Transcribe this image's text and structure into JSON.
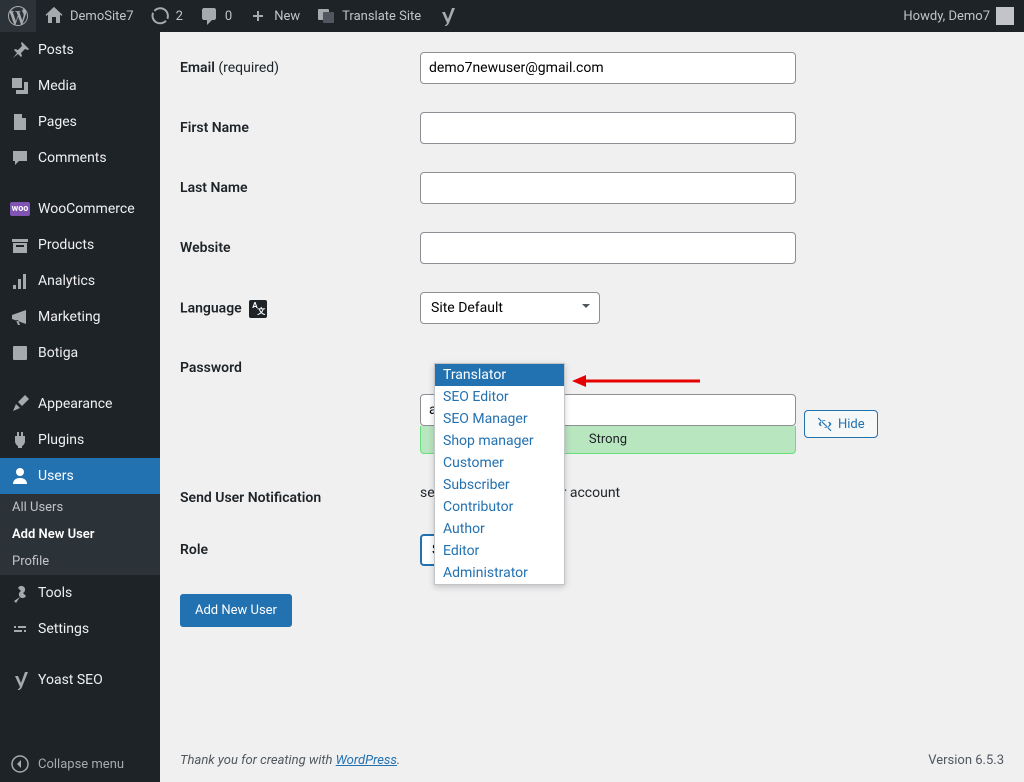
{
  "adminbar": {
    "site_name": "DemoSite7",
    "updates_count": "2",
    "comments_count": "0",
    "new_label": "New",
    "translate_label": "Translate Site",
    "howdy": "Howdy, Demo7"
  },
  "sidebar": {
    "posts": "Posts",
    "media": "Media",
    "pages": "Pages",
    "comments": "Comments",
    "woocommerce": "WooCommerce",
    "products": "Products",
    "analytics": "Analytics",
    "marketing": "Marketing",
    "botiga": "Botiga",
    "appearance": "Appearance",
    "plugins": "Plugins",
    "users": "Users",
    "users_sub": {
      "all": "All Users",
      "add": "Add New User",
      "profile": "Profile"
    },
    "tools": "Tools",
    "settings": "Settings",
    "yoast": "Yoast SEO",
    "collapse": "Collapse menu"
  },
  "form": {
    "email_label": "Email",
    "email_required": "(required)",
    "email_value": "demo7newuser@gmail.com",
    "firstname_label": "First Name",
    "lastname_label": "Last Name",
    "website_label": "Website",
    "language_label": "Language",
    "language_value": "Site Default",
    "password_label": "Password",
    "password_value": "amb9(rluK",
    "hide_label": "Hide",
    "strength": "Strong",
    "notification_label": "Send User Notification",
    "notification_desc": "ser an email about their account",
    "role_label": "Role",
    "role_value": "Subscriber",
    "submit": "Add New User"
  },
  "role_options": {
    "o0": "Translator",
    "o1": "SEO Editor",
    "o2": "SEO Manager",
    "o3": "Shop manager",
    "o4": "Customer",
    "o5": "Subscriber",
    "o6": "Contributor",
    "o7": "Author",
    "o8": "Editor",
    "o9": "Administrator"
  },
  "footer": {
    "thanks": "Thank you for creating with ",
    "wp": "WordPress",
    "period": ".",
    "version": "Version 6.5.3"
  }
}
